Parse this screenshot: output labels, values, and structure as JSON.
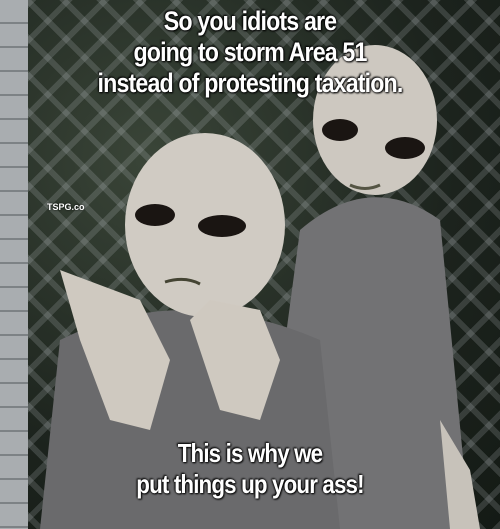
{
  "meme": {
    "top_caption": [
      "So you idiots are",
      "going to storm Area 51",
      "instead of protesting taxation."
    ],
    "bottom_caption": [
      "This is why we",
      "put things up your ass!"
    ],
    "watermark": "TSPG.co"
  },
  "colors": {
    "caption_text": "#ffffff",
    "alien_skin": "#c9c4bc",
    "suit": "#6e6e70"
  }
}
